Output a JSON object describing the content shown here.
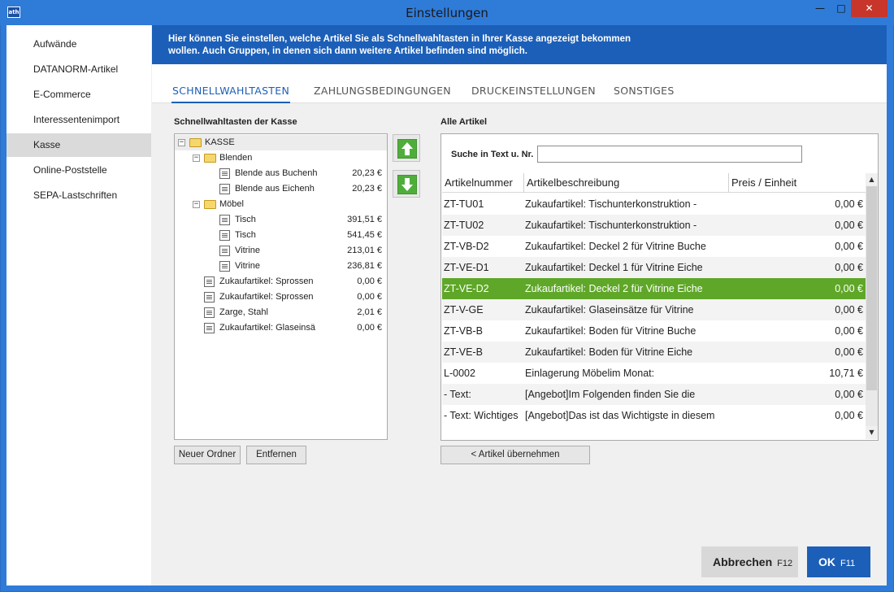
{
  "window": {
    "title": "Einstellungen",
    "icon_text": "ath",
    "min_glyph": "—",
    "max_glyph": "□",
    "close_glyph": "✕"
  },
  "sidebar": {
    "items": [
      {
        "label": "Aufwände",
        "active": false
      },
      {
        "label": "DATANORM-Artikel",
        "active": false
      },
      {
        "label": "E-Commerce",
        "active": false
      },
      {
        "label": "Interessentenimport",
        "active": false
      },
      {
        "label": "Kasse",
        "active": true
      },
      {
        "label": "Online-Poststelle",
        "active": false
      },
      {
        "label": "SEPA-Lastschriften",
        "active": false
      }
    ]
  },
  "banner": {
    "line1": "Hier können Sie einstellen, welche Artikel Sie als Schnellwahltasten in Ihrer Kasse angezeigt bekommen",
    "line2": "wollen. Auch Gruppen, in denen sich dann weitere Artikel befinden sind möglich."
  },
  "tabs": [
    {
      "label": "SCHNELLWAHLTASTEN",
      "active": true
    },
    {
      "label": "ZAHLUNGSBEDINGUNGEN",
      "active": false
    },
    {
      "label": "DRUCKEINSTELLUNGEN",
      "active": false
    },
    {
      "label": "SONSTIGES",
      "active": false
    }
  ],
  "left_panel": {
    "title": "Schnellwahltasten der Kasse",
    "tree": [
      {
        "level": 0,
        "type": "folder",
        "expander": "−",
        "name": "KASSE",
        "price": ""
      },
      {
        "level": 1,
        "type": "folder",
        "expander": "−",
        "name": "Blenden",
        "price": ""
      },
      {
        "level": 2,
        "type": "item",
        "expander": "",
        "name": "Blende aus Buchenh",
        "price": "20,23 €"
      },
      {
        "level": 2,
        "type": "item",
        "expander": "",
        "name": "Blende aus Eichenh",
        "price": "20,23 €"
      },
      {
        "level": 1,
        "type": "folder",
        "expander": "−",
        "name": "Möbel",
        "price": ""
      },
      {
        "level": 2,
        "type": "item",
        "expander": "",
        "name": "Tisch",
        "price": "391,51 €"
      },
      {
        "level": 2,
        "type": "item",
        "expander": "",
        "name": "Tisch",
        "price": "541,45 €"
      },
      {
        "level": 2,
        "type": "item",
        "expander": "",
        "name": "Vitrine",
        "price": "213,01 €"
      },
      {
        "level": 2,
        "type": "item",
        "expander": "",
        "name": "Vitrine",
        "price": "236,81 €"
      },
      {
        "level": 1,
        "type": "item",
        "expander": "",
        "name": "Zukaufartikel: Sprossen",
        "price": "0,00 €"
      },
      {
        "level": 1,
        "type": "item",
        "expander": "",
        "name": "Zukaufartikel: Sprossen",
        "price": "0,00 €"
      },
      {
        "level": 1,
        "type": "item",
        "expander": "",
        "name": "Zarge, Stahl",
        "price": "2,01 €"
      },
      {
        "level": 1,
        "type": "item",
        "expander": "",
        "name": "Zukaufartikel: Glaseinsä",
        "price": "0,00 €"
      }
    ],
    "new_folder_label": "Neuer Ordner",
    "remove_label": "Entfernen"
  },
  "right_panel": {
    "title": "Alle Artikel",
    "search_label": "Suche in Text u. Nr.",
    "search_value": "",
    "columns": [
      "Artikelnummer",
      "Artikelbeschreibung",
      "Preis / Einheit"
    ],
    "rows": [
      {
        "nr": "ZT-TU01",
        "desc": "Zukaufartikel: Tischunterkonstruktion -",
        "price": "0,00 €",
        "selected": false
      },
      {
        "nr": "ZT-TU02",
        "desc": "Zukaufartikel: Tischunterkonstruktion -",
        "price": "0,00 €",
        "selected": false
      },
      {
        "nr": "ZT-VB-D2",
        "desc": "Zukaufartikel: Deckel 2 für Vitrine Buche",
        "price": "0,00 €",
        "selected": false
      },
      {
        "nr": "ZT-VE-D1",
        "desc": "Zukaufartikel: Deckel 1 für Vitrine Eiche",
        "price": "0,00 €",
        "selected": false
      },
      {
        "nr": "ZT-VE-D2",
        "desc": "Zukaufartikel: Deckel 2 für Vitrine Eiche",
        "price": "0,00 €",
        "selected": true
      },
      {
        "nr": "ZT-V-GE",
        "desc": "Zukaufartikel: Glaseinsätze für Vitrine",
        "price": "0,00 €",
        "selected": false
      },
      {
        "nr": "ZT-VB-B",
        "desc": "Zukaufartikel: Boden für Vitrine Buche",
        "price": "0,00 €",
        "selected": false
      },
      {
        "nr": "ZT-VE-B",
        "desc": "Zukaufartikel: Boden für Vitrine Eiche",
        "price": "0,00 €",
        "selected": false
      },
      {
        "nr": "L-0002",
        "desc": "Einlagerung Möbelim Monat:",
        "price": "10,71 €",
        "selected": false
      },
      {
        "nr": "- Text:",
        "desc": "[Angebot]Im Folgenden finden Sie die",
        "price": "0,00 €",
        "selected": false
      },
      {
        "nr": "- Text: Wichtiges",
        "desc": "[Angebot]Das ist das Wichtigste in diesem",
        "price": "0,00 €",
        "selected": false
      }
    ],
    "take_over_label": "< Artikel übernehmen",
    "scroll_up_glyph": "▲",
    "scroll_down_glyph": "▼"
  },
  "footer": {
    "cancel_label": "Abbrechen",
    "cancel_key": "F12",
    "ok_label": "OK",
    "ok_key": "F11"
  },
  "colors": {
    "accent": "#1c5fb8",
    "selection": "#5fa728",
    "move_arrows": "#4fae3a"
  }
}
